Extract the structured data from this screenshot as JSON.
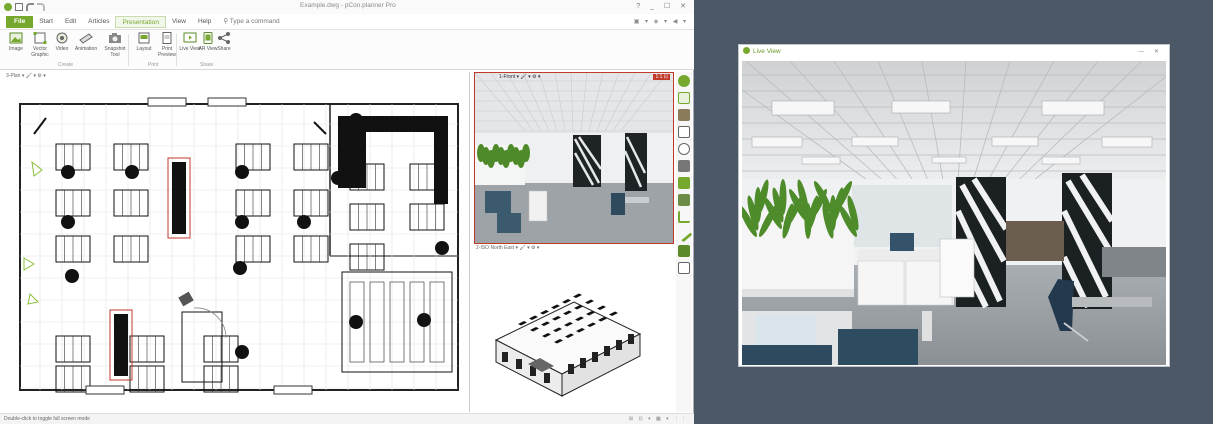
{
  "app": {
    "title": "Example.dwg - pCon.planner Pro",
    "window_controls": "? _ ☐ ✕",
    "menu": [
      {
        "label": "File"
      },
      {
        "label": "Start"
      },
      {
        "label": "Edit"
      },
      {
        "label": "Articles"
      },
      {
        "label": "Presentation"
      },
      {
        "label": "View"
      },
      {
        "label": "Help"
      }
    ],
    "command_placeholder": "Type a command",
    "menu_right": "▣ ▾ ◈ ▾ ◀ ▾",
    "accent": "#76a82e",
    "ribbon": {
      "buttons": [
        {
          "label": "Image",
          "icon": "image-icon"
        },
        {
          "label": "Vector Graphic",
          "icon": "vector-graphic-icon"
        },
        {
          "label": "Video",
          "icon": "video-icon"
        },
        {
          "label": "Animation",
          "icon": "animation-icon"
        },
        {
          "label": "Snapshot Tool",
          "icon": "camera-icon"
        },
        {
          "label": "Layout",
          "icon": "layout-icon"
        },
        {
          "label": "Print Preview",
          "icon": "print-preview-icon"
        },
        {
          "label": "Live View",
          "icon": "live-view-icon"
        },
        {
          "label": "AR View",
          "icon": "ar-view-icon"
        },
        {
          "label": "Share",
          "icon": "share-icon"
        }
      ],
      "groups": [
        "Create",
        "Print",
        "Share"
      ]
    }
  },
  "viewports": {
    "plan_label": "3-Plan ▾ 🖌 ▾ ⚙ ▾",
    "render_label": "1-Front ▾ 🖌 ▾ ⚙ ▾",
    "render_badge": "1:1 ⊡",
    "iso_label": "2-ISO North East ▾ 🖌 ▾ ⚙ ▾"
  },
  "statusbar": {
    "hint": "Double-click to toggle full screen mode",
    "right": "⊞ ⊡ ▾ ▦ ▾ ⋮⋮"
  },
  "live_view": {
    "title": "Live View",
    "controls": "— ✕"
  }
}
